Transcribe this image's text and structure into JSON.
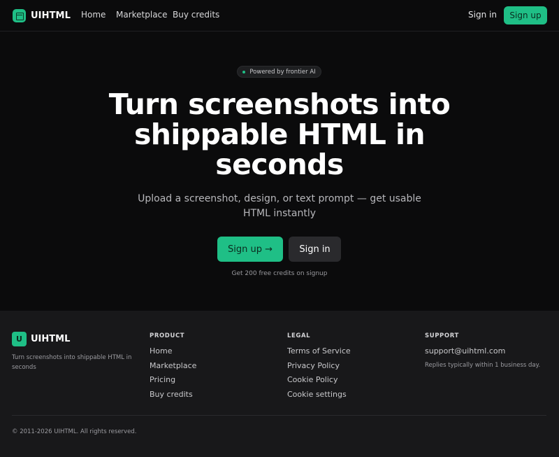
{
  "nav": {
    "brand": "UIHTML",
    "links": [
      "Home",
      "Marketplace",
      "Buy credits"
    ],
    "signin": "Sign in",
    "signup": "Sign up"
  },
  "hero": {
    "badge": "Powered by frontier AI",
    "title": "Turn screenshots into shippable HTML in seconds",
    "subtitle": "Upload a screenshot, design, or text prompt — get usable HTML instantly",
    "primary_button": "Sign up →",
    "secondary_button": "Sign in",
    "note": "Get 200 free credits on signup"
  },
  "footer": {
    "logo_letter": "U",
    "brand": "UIHTML",
    "tagline": "Turn screenshots into shippable HTML in seconds",
    "product": {
      "heading": "PRODUCT",
      "links": [
        "Home",
        "Marketplace",
        "Pricing",
        "Buy credits"
      ]
    },
    "legal": {
      "heading": "LEGAL",
      "links": [
        "Terms of Service",
        "Privacy Policy",
        "Cookie Policy",
        "Cookie settings"
      ]
    },
    "support": {
      "heading": "SUPPORT",
      "email": "support@uihtml.com",
      "note": "Replies typically within 1 business day."
    },
    "copyright": "© 2011-2026 UIHTML. All rights reserved."
  },
  "colors": {
    "accent": "#1fbf86",
    "background": "#0b0b0c",
    "footer_background": "#18181a"
  }
}
